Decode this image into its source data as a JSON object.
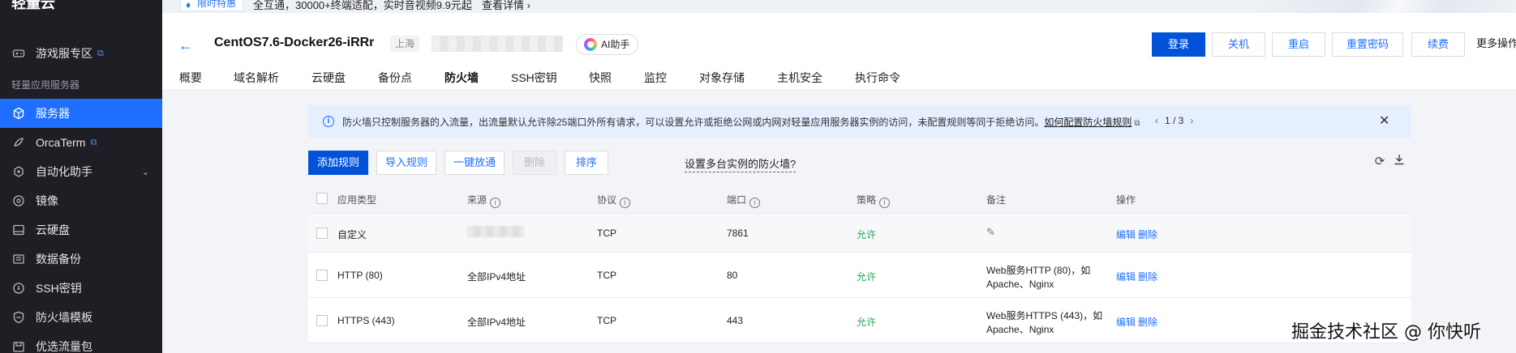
{
  "sidebar": {
    "brand": "轻量云",
    "section_label": "轻量应用服务器",
    "items": [
      {
        "label": "游戏服专区",
        "icon": "gamepad-icon",
        "external": true
      },
      {
        "label": "服务器",
        "icon": "server-cube-icon",
        "active": true
      },
      {
        "label": "OrcaTerm",
        "icon": "terminal-icon",
        "external": true
      },
      {
        "label": "自动化助手",
        "icon": "automation-icon",
        "expandable": true
      },
      {
        "label": "镜像",
        "icon": "image-disc-icon"
      },
      {
        "label": "云硬盘",
        "icon": "cloud-disk-icon"
      },
      {
        "label": "数据备份",
        "icon": "backup-icon"
      },
      {
        "label": "SSH密钥",
        "icon": "key-icon"
      },
      {
        "label": "防火墙模板",
        "icon": "shield-icon"
      },
      {
        "label": "优选流量包",
        "icon": "package-icon"
      }
    ]
  },
  "promo": {
    "badge": "限时特惠",
    "text": "全互通，30000+终端适配，实时音视频9.9元起",
    "link": "查看详情 ›"
  },
  "header": {
    "title": "CentOS7.6-Docker26-iRRr",
    "region": "上海",
    "ai_label": "AI助手",
    "buttons": {
      "login": "登录",
      "shutdown": "关机",
      "restart": "重启",
      "reset_password": "重置密码",
      "renew": "续费",
      "more": "更多操作"
    }
  },
  "tabs": [
    "概要",
    "域名解析",
    "云硬盘",
    "备份点",
    "防火墙",
    "SSH密钥",
    "快照",
    "监控",
    "对象存储",
    "主机安全",
    "执行命令"
  ],
  "active_tab": "防火墙",
  "notice": {
    "message": "防火墙只控制服务器的入流量，出流量默认允许除25端口外所有请求，可以设置允许或拒绝公网或内网对轻量应用服务器实例的访问，未配置规则等同于拒绝访问。",
    "help_link": "如何配置防火墙规则",
    "pager": "1 / 3"
  },
  "toolbar": {
    "add_rule": "添加规则",
    "import_rule": "导入规则",
    "one_click_open": "一键放通",
    "delete": "删除",
    "sort": "排序",
    "multi_instance_link": "设置多台实例的防火墙?"
  },
  "table": {
    "columns": [
      "应用类型",
      "来源",
      "协议",
      "端口",
      "策略",
      "备注",
      "操作"
    ],
    "rows": [
      {
        "type": "自定义",
        "source": "",
        "protocol": "TCP",
        "port": "7861",
        "policy": "允许",
        "note": "",
        "edit": "编辑",
        "delete": "删除"
      },
      {
        "type": "HTTP (80)",
        "source": "全部IPv4地址",
        "protocol": "TCP",
        "port": "80",
        "policy": "允许",
        "note_line1": "Web服务HTTP (80)，如",
        "note_line2": "Apache、Nginx",
        "edit": "编辑",
        "delete": "删除"
      },
      {
        "type": "HTTPS (443)",
        "source": "全部IPv4地址",
        "protocol": "TCP",
        "port": "443",
        "policy": "允许",
        "note_line1": "Web服务HTTPS (443)，如",
        "note_line2": "Apache、Nginx",
        "edit": "编辑",
        "delete": "删除"
      }
    ]
  },
  "watermark": "掘金技术社区 @ 你快听"
}
